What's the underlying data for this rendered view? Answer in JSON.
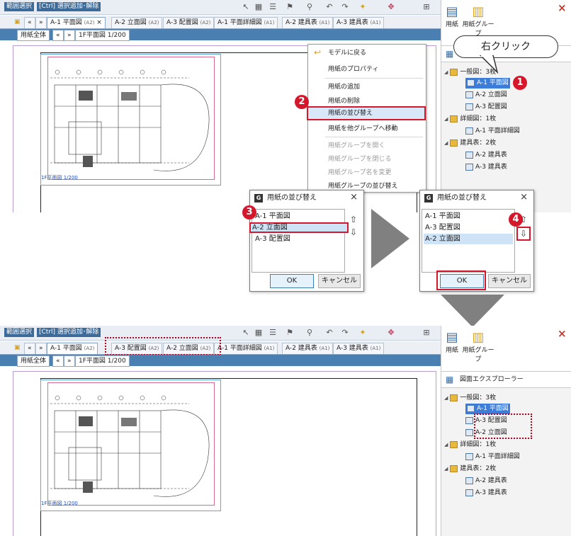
{
  "toolbar": {
    "range_select": "範囲選択",
    "ctrl_hint": "[Ctrl] 選択追加･解除"
  },
  "tabs_before": [
    {
      "label": "A-1 平面図",
      "size": "(A2)",
      "active": true
    },
    {
      "label": "A-2 立面図",
      "size": "(A2)"
    },
    {
      "label": "A-3 配置図",
      "size": "(A2)"
    },
    {
      "label": "A-1 平面詳細図",
      "size": "(A1)"
    },
    {
      "label": "A-2 建具表",
      "size": "(A1)"
    },
    {
      "label": "A-3 建具表",
      "size": "(A1)"
    }
  ],
  "tabs_after": [
    {
      "label": "A-1 平面図",
      "size": "(A2)",
      "active": true
    },
    {
      "label": "A-3 配置図",
      "size": "(A2)"
    },
    {
      "label": "A-2 立面図",
      "size": "(A2)"
    },
    {
      "label": "A-1 平面詳細図",
      "size": "(A1)"
    },
    {
      "label": "A-2 建具表",
      "size": "(A1)"
    },
    {
      "label": "A-3 建具表",
      "size": "(A1)"
    }
  ],
  "subtabs": {
    "all": "用紙全体",
    "prev": "«",
    "next": "»",
    "view": "1F平面図 1/200"
  },
  "nav": {
    "prev": "«",
    "next": "»",
    "close": "×"
  },
  "plan_label": "1F平面図 1/200",
  "right_panel": {
    "paper": "用紙",
    "paper_group": "用紙グループ",
    "explorer": "図面エクスプローラー",
    "close": "×"
  },
  "tree_before": [
    {
      "label": "一般図：3枚",
      "type": "folder"
    },
    {
      "label": "A-1 平面図",
      "type": "sheet",
      "selected": true
    },
    {
      "label": "A-2 立面図",
      "type": "sheet"
    },
    {
      "label": "A-3 配置図",
      "type": "sheet"
    },
    {
      "label": "詳細図：1枚",
      "type": "folder"
    },
    {
      "label": "A-1 平面詳細図",
      "type": "sheet"
    },
    {
      "label": "建具表：2枚",
      "type": "folder"
    },
    {
      "label": "A-2 建具表",
      "type": "sheet"
    },
    {
      "label": "A-3 建具表",
      "type": "sheet"
    }
  ],
  "tree_after": [
    {
      "label": "一般図：3枚",
      "type": "folder"
    },
    {
      "label": "A-1 平面図",
      "type": "sheet",
      "selected": true
    },
    {
      "label": "A-3 配置図",
      "type": "sheet"
    },
    {
      "label": "A-2 立面図",
      "type": "sheet"
    },
    {
      "label": "詳細図：1枚",
      "type": "folder"
    },
    {
      "label": "A-1 平面詳細図",
      "type": "sheet"
    },
    {
      "label": "建具表：2枚",
      "type": "folder"
    },
    {
      "label": "A-2 建具表",
      "type": "sheet"
    },
    {
      "label": "A-3 建具表",
      "type": "sheet"
    }
  ],
  "callout": "右クリック",
  "context_menu": [
    {
      "label": "モデルに戻る"
    },
    {
      "label": "用紙のプロパティ"
    },
    {
      "label": "用紙の追加"
    },
    {
      "label": "用紙の削除"
    },
    {
      "label": "用紙の並び替え",
      "highlight": true
    },
    {
      "label": "用紙を他グループへ移動"
    },
    {
      "label": "用紙グループを開く",
      "disabled": true
    },
    {
      "label": "用紙グループを閉じる",
      "disabled": true
    },
    {
      "label": "用紙グループ名を変更",
      "disabled": true
    },
    {
      "label": "用紙グループの並び替え"
    }
  ],
  "dialog1": {
    "title": "用紙の並び替え",
    "items": [
      "A-1 平面図",
      "A-2 立面図",
      "A-3 配置図"
    ],
    "ok": "OK",
    "cancel": "キャンセル"
  },
  "dialog2": {
    "title": "用紙の並び替え",
    "items": [
      "A-1 平面図",
      "A-3 配置図",
      "A-2 立面図"
    ],
    "ok": "OK",
    "cancel": "キャンセル"
  },
  "steps": [
    "1",
    "2",
    "3",
    "4"
  ],
  "icons": {
    "up": "⇧",
    "down": "⇩",
    "dialog_logo": "G"
  }
}
